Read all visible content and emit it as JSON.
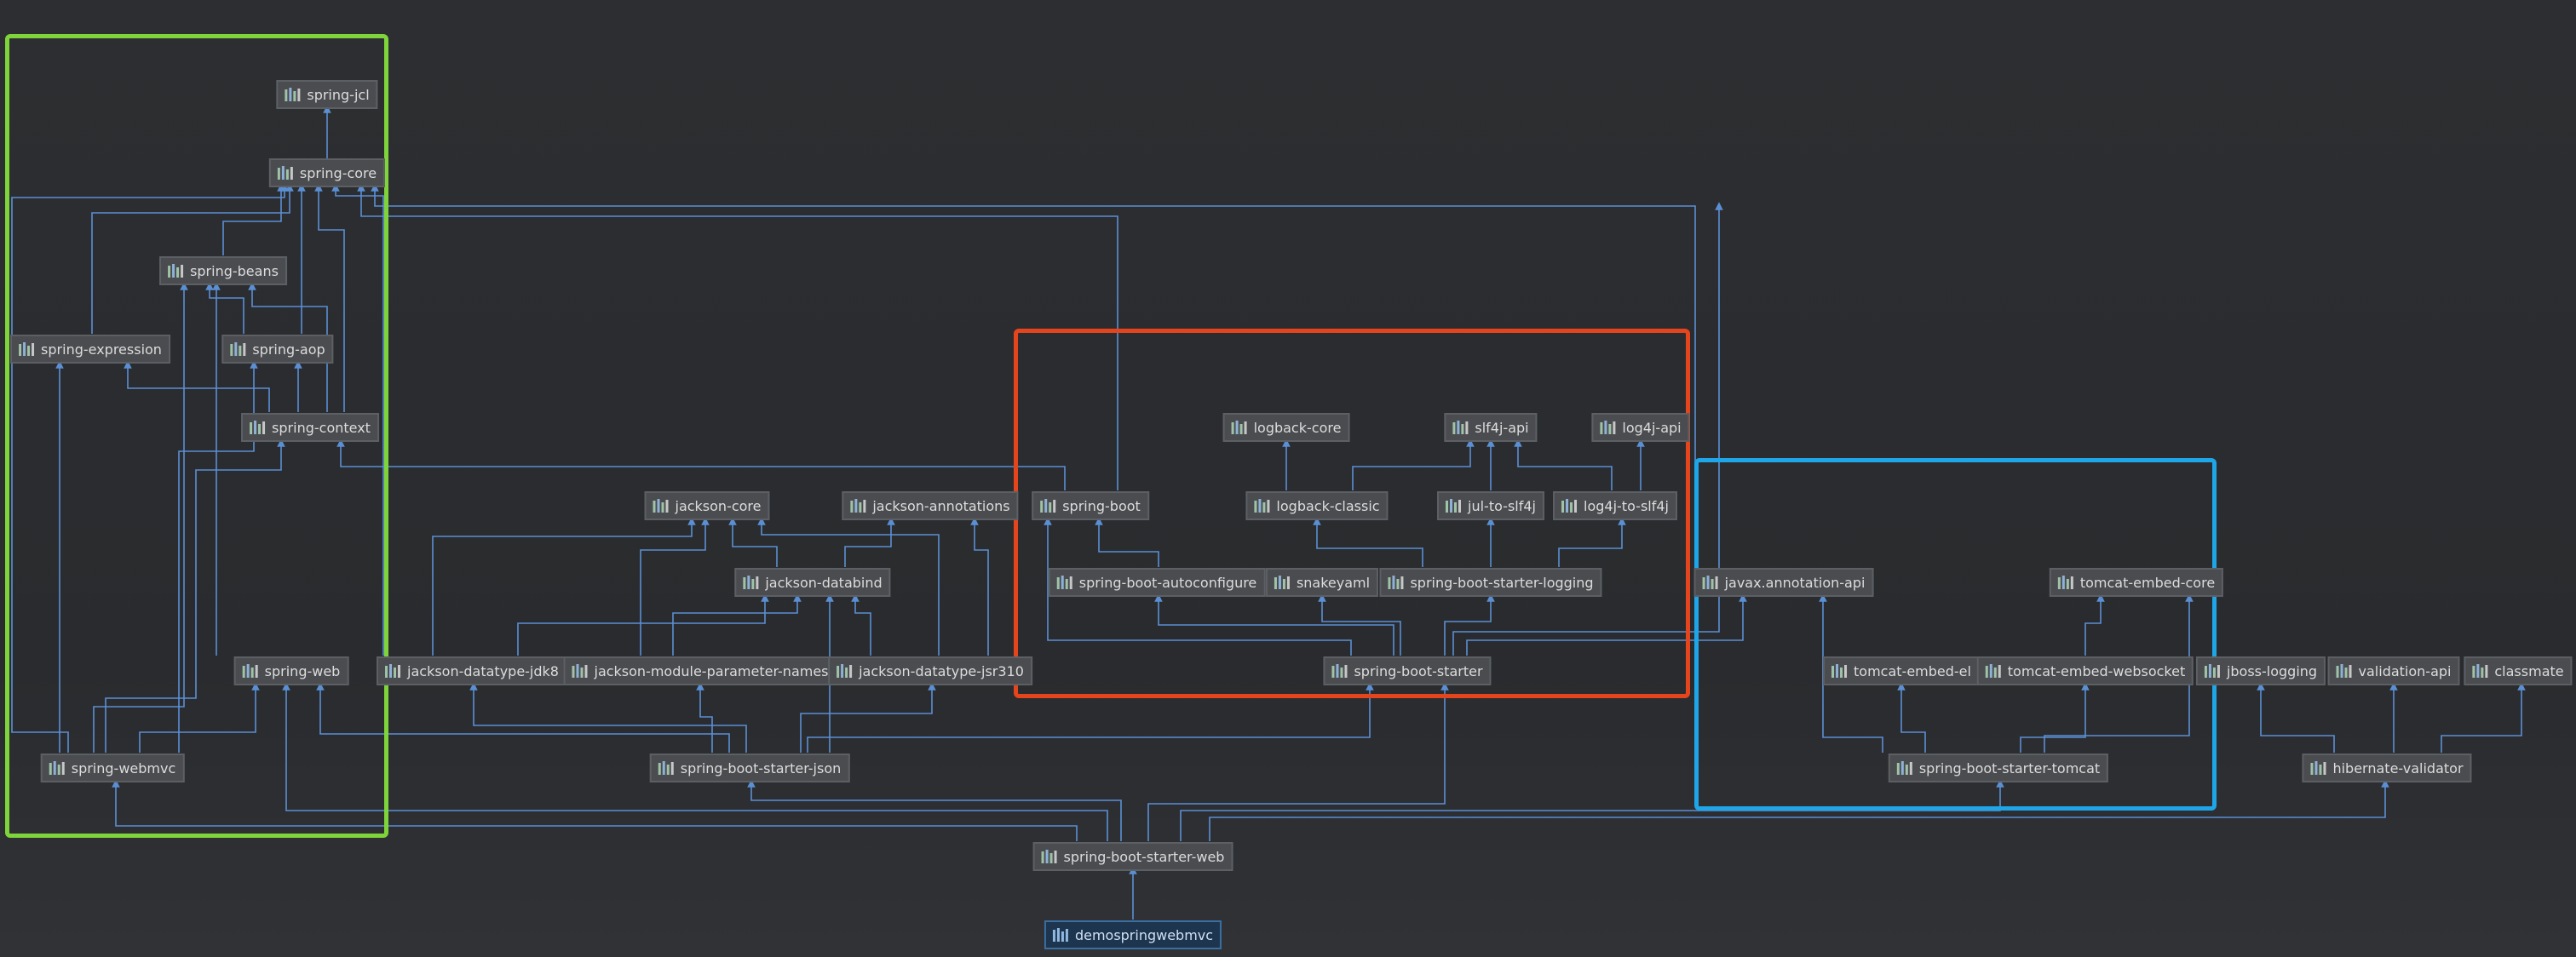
{
  "colors": {
    "background": "#2b2d30",
    "edge": "#5b8fd4",
    "node_fill": "#4a4c50",
    "node_border": "#5c5f64",
    "node_text": "#dcdcdc",
    "highlight_green": "#7ed43a",
    "highlight_red": "#e5451c",
    "highlight_blue": "#1ea6e8"
  },
  "icon": "library-bars-icon",
  "root": "demospringwebmvc",
  "nodes": {
    "spring_jcl": "spring-jcl",
    "spring_core": "spring-core",
    "spring_beans": "spring-beans",
    "spring_expression": "spring-expression",
    "spring_aop": "spring-aop",
    "spring_context": "spring-context",
    "spring_web": "spring-web",
    "spring_webmvc": "spring-webmvc",
    "jackson_core": "jackson-core",
    "jackson_annotations": "jackson-annotations",
    "jackson_databind": "jackson-databind",
    "jackson_datatype_jdk8": "jackson-datatype-jdk8",
    "jackson_module_parameter_names": "jackson-module-parameter-names",
    "jackson_datatype_jsr310": "jackson-datatype-jsr310",
    "spring_boot_starter_json": "spring-boot-starter-json",
    "spring_boot": "spring-boot",
    "spring_boot_autoconfigure": "spring-boot-autoconfigure",
    "snakeyaml": "snakeyaml",
    "spring_boot_starter_logging": "spring-boot-starter-logging",
    "spring_boot_starter": "spring-boot-starter",
    "logback_core": "logback-core",
    "slf4j_api": "slf4j-api",
    "log4j_api": "log4j-api",
    "logback_classic": "logback-classic",
    "jul_to_slf4j": "jul-to-slf4j",
    "log4j_to_slf4j": "log4j-to-slf4j",
    "javax_annotation_api": "javax.annotation-api",
    "tomcat_embed_core": "tomcat-embed-core",
    "tomcat_embed_el": "tomcat-embed-el",
    "tomcat_embed_websocket": "tomcat-embed-websocket",
    "spring_boot_starter_tomcat": "spring-boot-starter-tomcat",
    "jboss_logging": "jboss-logging",
    "validation_api": "validation-api",
    "classmate": "classmate",
    "hibernate_validator": "hibernate-validator",
    "spring_boot_starter_web": "spring-boot-starter-web"
  }
}
